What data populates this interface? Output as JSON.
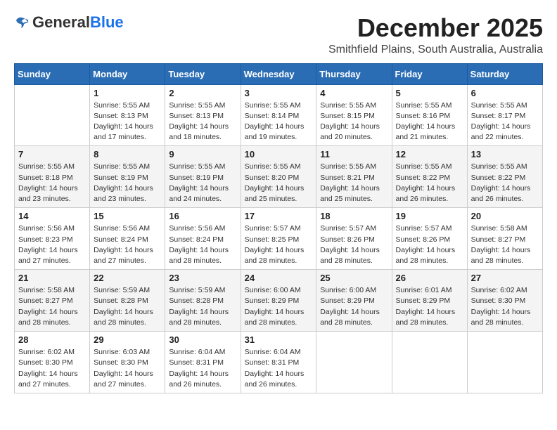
{
  "header": {
    "logo_general": "General",
    "logo_blue": "Blue",
    "month_title": "December 2025",
    "subtitle": "Smithfield Plains, South Australia, Australia"
  },
  "days_of_week": [
    "Sunday",
    "Monday",
    "Tuesday",
    "Wednesday",
    "Thursday",
    "Friday",
    "Saturday"
  ],
  "weeks": [
    [
      {
        "day": "",
        "info": ""
      },
      {
        "day": "1",
        "info": "Sunrise: 5:55 AM\nSunset: 8:13 PM\nDaylight: 14 hours\nand 17 minutes."
      },
      {
        "day": "2",
        "info": "Sunrise: 5:55 AM\nSunset: 8:13 PM\nDaylight: 14 hours\nand 18 minutes."
      },
      {
        "day": "3",
        "info": "Sunrise: 5:55 AM\nSunset: 8:14 PM\nDaylight: 14 hours\nand 19 minutes."
      },
      {
        "day": "4",
        "info": "Sunrise: 5:55 AM\nSunset: 8:15 PM\nDaylight: 14 hours\nand 20 minutes."
      },
      {
        "day": "5",
        "info": "Sunrise: 5:55 AM\nSunset: 8:16 PM\nDaylight: 14 hours\nand 21 minutes."
      },
      {
        "day": "6",
        "info": "Sunrise: 5:55 AM\nSunset: 8:17 PM\nDaylight: 14 hours\nand 22 minutes."
      }
    ],
    [
      {
        "day": "7",
        "info": "Sunrise: 5:55 AM\nSunset: 8:18 PM\nDaylight: 14 hours\nand 23 minutes."
      },
      {
        "day": "8",
        "info": "Sunrise: 5:55 AM\nSunset: 8:19 PM\nDaylight: 14 hours\nand 23 minutes."
      },
      {
        "day": "9",
        "info": "Sunrise: 5:55 AM\nSunset: 8:19 PM\nDaylight: 14 hours\nand 24 minutes."
      },
      {
        "day": "10",
        "info": "Sunrise: 5:55 AM\nSunset: 8:20 PM\nDaylight: 14 hours\nand 25 minutes."
      },
      {
        "day": "11",
        "info": "Sunrise: 5:55 AM\nSunset: 8:21 PM\nDaylight: 14 hours\nand 25 minutes."
      },
      {
        "day": "12",
        "info": "Sunrise: 5:55 AM\nSunset: 8:22 PM\nDaylight: 14 hours\nand 26 minutes."
      },
      {
        "day": "13",
        "info": "Sunrise: 5:55 AM\nSunset: 8:22 PM\nDaylight: 14 hours\nand 26 minutes."
      }
    ],
    [
      {
        "day": "14",
        "info": "Sunrise: 5:56 AM\nSunset: 8:23 PM\nDaylight: 14 hours\nand 27 minutes."
      },
      {
        "day": "15",
        "info": "Sunrise: 5:56 AM\nSunset: 8:24 PM\nDaylight: 14 hours\nand 27 minutes."
      },
      {
        "day": "16",
        "info": "Sunrise: 5:56 AM\nSunset: 8:24 PM\nDaylight: 14 hours\nand 28 minutes."
      },
      {
        "day": "17",
        "info": "Sunrise: 5:57 AM\nSunset: 8:25 PM\nDaylight: 14 hours\nand 28 minutes."
      },
      {
        "day": "18",
        "info": "Sunrise: 5:57 AM\nSunset: 8:26 PM\nDaylight: 14 hours\nand 28 minutes."
      },
      {
        "day": "19",
        "info": "Sunrise: 5:57 AM\nSunset: 8:26 PM\nDaylight: 14 hours\nand 28 minutes."
      },
      {
        "day": "20",
        "info": "Sunrise: 5:58 AM\nSunset: 8:27 PM\nDaylight: 14 hours\nand 28 minutes."
      }
    ],
    [
      {
        "day": "21",
        "info": "Sunrise: 5:58 AM\nSunset: 8:27 PM\nDaylight: 14 hours\nand 28 minutes."
      },
      {
        "day": "22",
        "info": "Sunrise: 5:59 AM\nSunset: 8:28 PM\nDaylight: 14 hours\nand 28 minutes."
      },
      {
        "day": "23",
        "info": "Sunrise: 5:59 AM\nSunset: 8:28 PM\nDaylight: 14 hours\nand 28 minutes."
      },
      {
        "day": "24",
        "info": "Sunrise: 6:00 AM\nSunset: 8:29 PM\nDaylight: 14 hours\nand 28 minutes."
      },
      {
        "day": "25",
        "info": "Sunrise: 6:00 AM\nSunset: 8:29 PM\nDaylight: 14 hours\nand 28 minutes."
      },
      {
        "day": "26",
        "info": "Sunrise: 6:01 AM\nSunset: 8:29 PM\nDaylight: 14 hours\nand 28 minutes."
      },
      {
        "day": "27",
        "info": "Sunrise: 6:02 AM\nSunset: 8:30 PM\nDaylight: 14 hours\nand 28 minutes."
      }
    ],
    [
      {
        "day": "28",
        "info": "Sunrise: 6:02 AM\nSunset: 8:30 PM\nDaylight: 14 hours\nand 27 minutes."
      },
      {
        "day": "29",
        "info": "Sunrise: 6:03 AM\nSunset: 8:30 PM\nDaylight: 14 hours\nand 27 minutes."
      },
      {
        "day": "30",
        "info": "Sunrise: 6:04 AM\nSunset: 8:31 PM\nDaylight: 14 hours\nand 26 minutes."
      },
      {
        "day": "31",
        "info": "Sunrise: 6:04 AM\nSunset: 8:31 PM\nDaylight: 14 hours\nand 26 minutes."
      },
      {
        "day": "",
        "info": ""
      },
      {
        "day": "",
        "info": ""
      },
      {
        "day": "",
        "info": ""
      }
    ]
  ]
}
